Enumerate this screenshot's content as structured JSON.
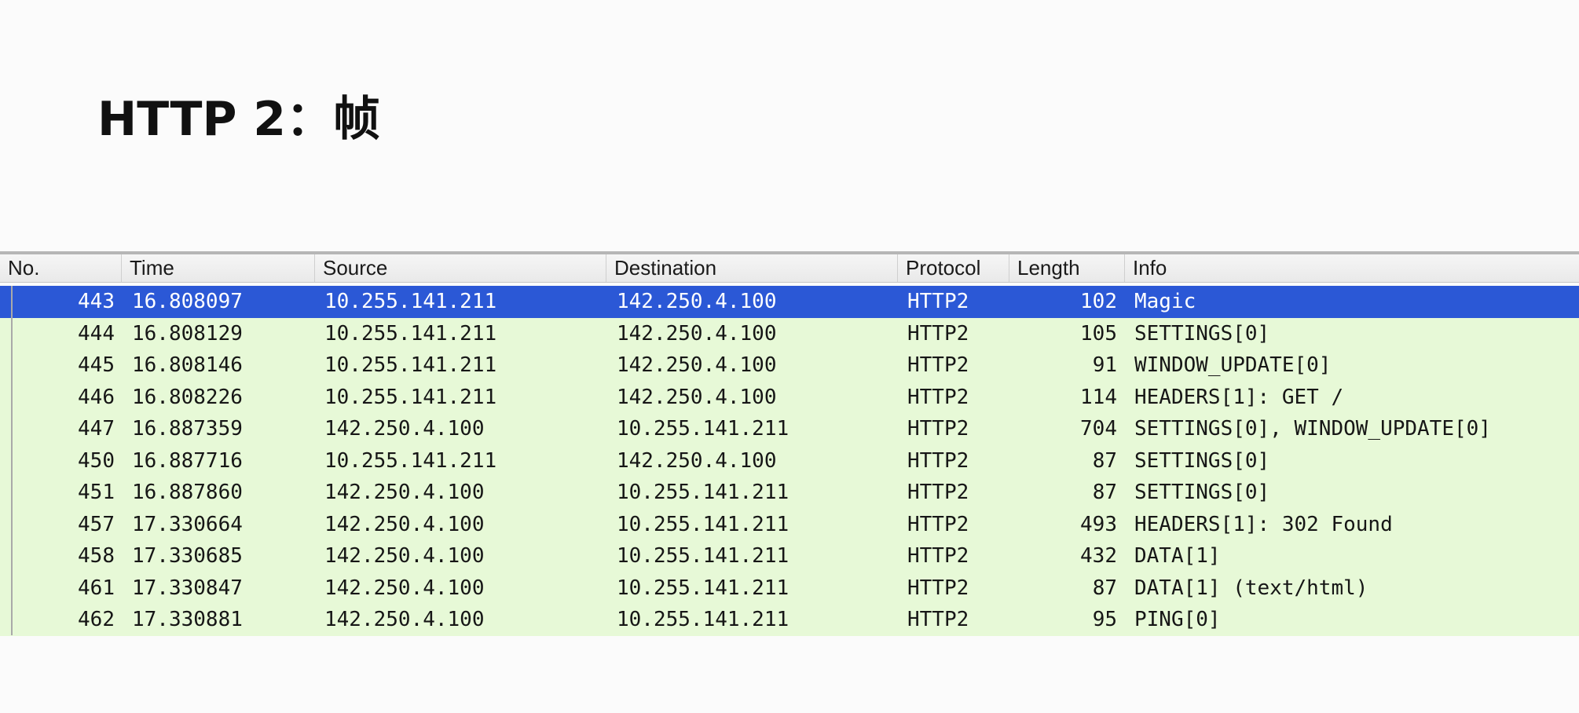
{
  "slide": {
    "title": "HTTP 2：帧"
  },
  "packet_list": {
    "columns": [
      "No.",
      "Time",
      "Source",
      "Destination",
      "Protocol",
      "Length",
      "Info"
    ],
    "selected_index": 0,
    "rows": [
      {
        "no": "443",
        "time": "16.808097",
        "source": "10.255.141.211",
        "destination": "142.250.4.100",
        "protocol": "HTTP2",
        "length": "102",
        "info": "Magic"
      },
      {
        "no": "444",
        "time": "16.808129",
        "source": "10.255.141.211",
        "destination": "142.250.4.100",
        "protocol": "HTTP2",
        "length": "105",
        "info": "SETTINGS[0]"
      },
      {
        "no": "445",
        "time": "16.808146",
        "source": "10.255.141.211",
        "destination": "142.250.4.100",
        "protocol": "HTTP2",
        "length": "91",
        "info": "WINDOW_UPDATE[0]"
      },
      {
        "no": "446",
        "time": "16.808226",
        "source": "10.255.141.211",
        "destination": "142.250.4.100",
        "protocol": "HTTP2",
        "length": "114",
        "info": "HEADERS[1]: GET /"
      },
      {
        "no": "447",
        "time": "16.887359",
        "source": "142.250.4.100",
        "destination": "10.255.141.211",
        "protocol": "HTTP2",
        "length": "704",
        "info": "SETTINGS[0], WINDOW_UPDATE[0]"
      },
      {
        "no": "450",
        "time": "16.887716",
        "source": "10.255.141.211",
        "destination": "142.250.4.100",
        "protocol": "HTTP2",
        "length": "87",
        "info": "SETTINGS[0]"
      },
      {
        "no": "451",
        "time": "16.887860",
        "source": "142.250.4.100",
        "destination": "10.255.141.211",
        "protocol": "HTTP2",
        "length": "87",
        "info": "SETTINGS[0]"
      },
      {
        "no": "457",
        "time": "17.330664",
        "source": "142.250.4.100",
        "destination": "10.255.141.211",
        "protocol": "HTTP2",
        "length": "493",
        "info": "HEADERS[1]: 302 Found"
      },
      {
        "no": "458",
        "time": "17.330685",
        "source": "142.250.4.100",
        "destination": "10.255.141.211",
        "protocol": "HTTP2",
        "length": "432",
        "info": "DATA[1]"
      },
      {
        "no": "461",
        "time": "17.330847",
        "source": "142.250.4.100",
        "destination": "10.255.141.211",
        "protocol": "HTTP2",
        "length": "87",
        "info": "DATA[1] (text/html)"
      },
      {
        "no": "462",
        "time": "17.330881",
        "source": "142.250.4.100",
        "destination": "10.255.141.211",
        "protocol": "HTTP2",
        "length": "95",
        "info": "PING[0]"
      }
    ]
  },
  "colors": {
    "row_background": "#e7f9d7",
    "selected_background": "#2b58d6",
    "selected_text": "#ffffff"
  }
}
